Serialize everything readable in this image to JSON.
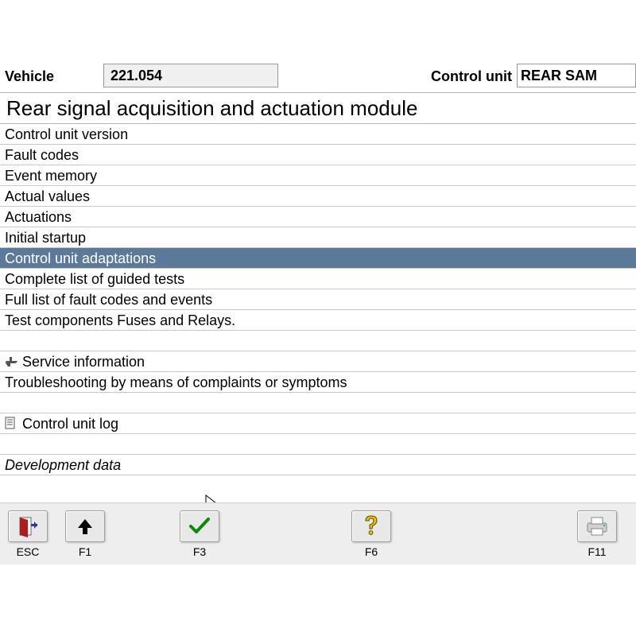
{
  "header": {
    "vehicle_label": "Vehicle",
    "vehicle_value": "221.054",
    "cu_label": "Control unit",
    "cu_value": "REAR SAM"
  },
  "title": "Rear signal acquisition and actuation module",
  "menu": [
    {
      "label": "Control unit version",
      "icon": "",
      "selected": false,
      "italic": false
    },
    {
      "label": "Fault codes",
      "icon": "",
      "selected": false,
      "italic": false
    },
    {
      "label": "Event memory",
      "icon": "",
      "selected": false,
      "italic": false
    },
    {
      "label": "Actual values",
      "icon": "",
      "selected": false,
      "italic": false
    },
    {
      "label": "Actuations",
      "icon": "",
      "selected": false,
      "italic": false
    },
    {
      "label": "Initial startup",
      "icon": "",
      "selected": false,
      "italic": false
    },
    {
      "label": "Control unit adaptations",
      "icon": "",
      "selected": true,
      "italic": false
    },
    {
      "label": "Complete list of guided tests",
      "icon": "",
      "selected": false,
      "italic": false
    },
    {
      "label": "Full list of fault codes and events",
      "icon": "",
      "selected": false,
      "italic": false
    },
    {
      "label": "Test components Fuses and Relays.",
      "icon": "",
      "selected": false,
      "italic": false
    },
    {
      "label": "",
      "icon": "",
      "selected": false,
      "italic": false,
      "spacer": true
    },
    {
      "label": "Service information",
      "icon": "wrench",
      "selected": false,
      "italic": false
    },
    {
      "label": "Troubleshooting by means of complaints or symptoms",
      "icon": "",
      "selected": false,
      "italic": false
    },
    {
      "label": "",
      "icon": "",
      "selected": false,
      "italic": false,
      "spacer": true
    },
    {
      "label": "Control unit log",
      "icon": "doc",
      "selected": false,
      "italic": false
    },
    {
      "label": "",
      "icon": "",
      "selected": false,
      "italic": false,
      "spacer": true
    },
    {
      "label": "Development data",
      "icon": "",
      "selected": false,
      "italic": true
    }
  ],
  "footer": {
    "esc": "ESC",
    "f1": "F1",
    "f3": "F3",
    "f6": "F6",
    "f11": "F11"
  }
}
